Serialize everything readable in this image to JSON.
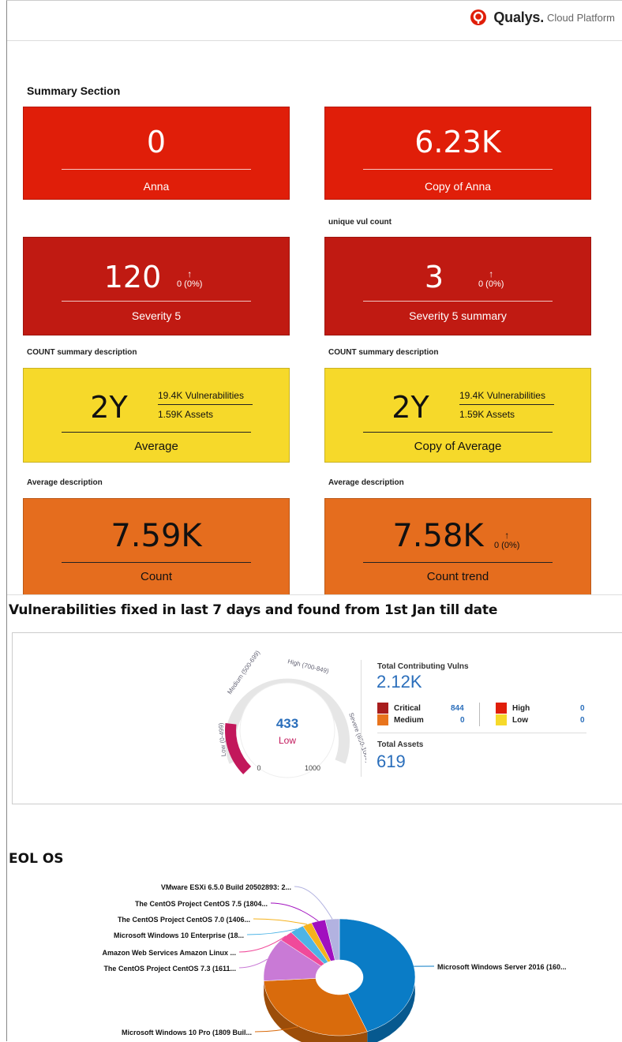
{
  "header": {
    "brand_name": "Qualys.",
    "brand_sub": "Cloud Platform"
  },
  "summary": {
    "title": "Summary Section",
    "cards": [
      {
        "value": "0",
        "label": "Anna"
      },
      {
        "value": "6.23K",
        "label": "Copy of Anna",
        "description": "unique vul count"
      },
      {
        "value": "120",
        "label": "Severity 5",
        "trend": "0 (0%)",
        "description": "COUNT summary description"
      },
      {
        "value": "3",
        "label": "Severity 5 summary",
        "trend": "0 (0%)",
        "description": "COUNT summary description"
      },
      {
        "value": "2Y",
        "label": "Average",
        "stat1": "19.4K Vulnerabilities",
        "stat2": "1.59K Assets",
        "description": "Average description"
      },
      {
        "value": "2Y",
        "label": "Copy of Average",
        "stat1": "19.4K Vulnerabilities",
        "stat2": "1.59K Assets",
        "description": "Average description"
      },
      {
        "value": "7.59K",
        "label": "Count"
      },
      {
        "value": "7.58K",
        "label": "Count trend",
        "trend": "0 (0%)"
      }
    ],
    "colors": {
      "red": "#e01e09",
      "darkred": "#c01a12",
      "yellow": "#f6d92a",
      "orange": "#e56d1e"
    }
  },
  "vuln_section": {
    "title": "Vulnerabilities fixed in last 7 days and found from 1st Jan till date",
    "gauge": {
      "value": "433",
      "rating": "Low",
      "min": "0",
      "max": "1000",
      "band_low": "Low (0-499)",
      "band_medium": "Medium (500-699)",
      "band_high": "High (700-849)",
      "band_severe": "Severe (850-1000)",
      "score": 433
    },
    "total_vulns_label": "Total Contributing Vulns",
    "total_vulns": "2.12K",
    "legend": [
      {
        "name": "Critical",
        "value": "844",
        "color": "#a81d1d"
      },
      {
        "name": "Medium",
        "value": "0",
        "color": "#e8741d"
      },
      {
        "name": "High",
        "value": "0",
        "color": "#e01e09"
      },
      {
        "name": "Low",
        "value": "0",
        "color": "#f6d92a"
      }
    ],
    "total_assets_label": "Total Assets",
    "total_assets": "619"
  },
  "eol": {
    "title": "EOL OS",
    "chart_data": {
      "type": "pie",
      "labels": [
        "Microsoft Windows Server 2016 (160...",
        "Microsoft Windows 10 Pro (1809 Buil...",
        "The CentOS Project CentOS 7.3 (1611...",
        "Amazon Web Services Amazon Linux ...",
        "Microsoft Windows 10 Enterprise (18...",
        "The CentOS Project CentOS 7.0 (1406...",
        "The CentOS Project CentOS 7.5 (1804...",
        "VMware ESXi 6.5.0 Build 20502893: 2..."
      ],
      "values": [
        44,
        30,
        12,
        3,
        3,
        2,
        3,
        3
      ],
      "colors": [
        "#0a7cc6",
        "#d96b0c",
        "#c97ad6",
        "#f04a9a",
        "#4db4e6",
        "#f5b21c",
        "#a10fbf",
        "#b2b2e0"
      ]
    }
  }
}
